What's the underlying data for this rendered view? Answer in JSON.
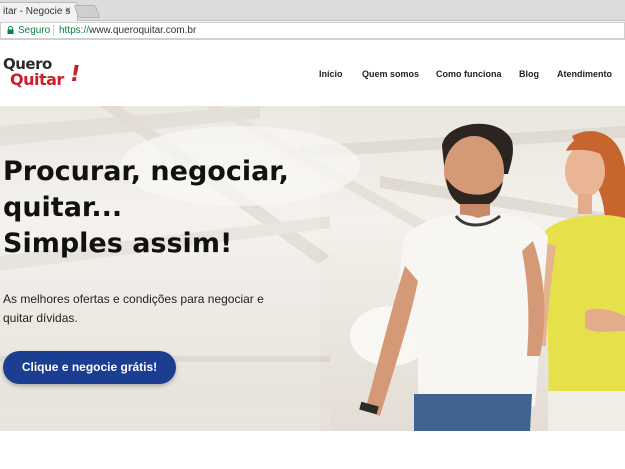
{
  "browser": {
    "tab_title": "itar - Negocie s",
    "tab_close": "×",
    "secure_label": "Seguro",
    "url_protocol": "https://",
    "url_host": "www.queroquitar.com.br"
  },
  "logo": {
    "line1": "Quero",
    "line2": "Quitar",
    "bang": "!",
    "colors": {
      "dark": "#2b2b2b",
      "red": "#cc1f2b"
    }
  },
  "nav": {
    "items": [
      {
        "label": "Início"
      },
      {
        "label": "Quem somos"
      },
      {
        "label": "Como funciona"
      },
      {
        "label": "Blog"
      },
      {
        "label": "Atendimento"
      }
    ]
  },
  "hero": {
    "title_lines": [
      "Procurar, negociar,",
      "quitar...",
      "Simples assim!"
    ],
    "subtitle_lines": [
      "As melhores ofertas e condições para negociar e",
      "quitar dívidas."
    ],
    "cta_label": "Clique e negocie grátis!",
    "colors": {
      "cta": "#1b3d92",
      "shirt_man": "#f7f6f3",
      "shirt_woman": "#e6e14a",
      "hair_woman": "#c8652e"
    }
  }
}
